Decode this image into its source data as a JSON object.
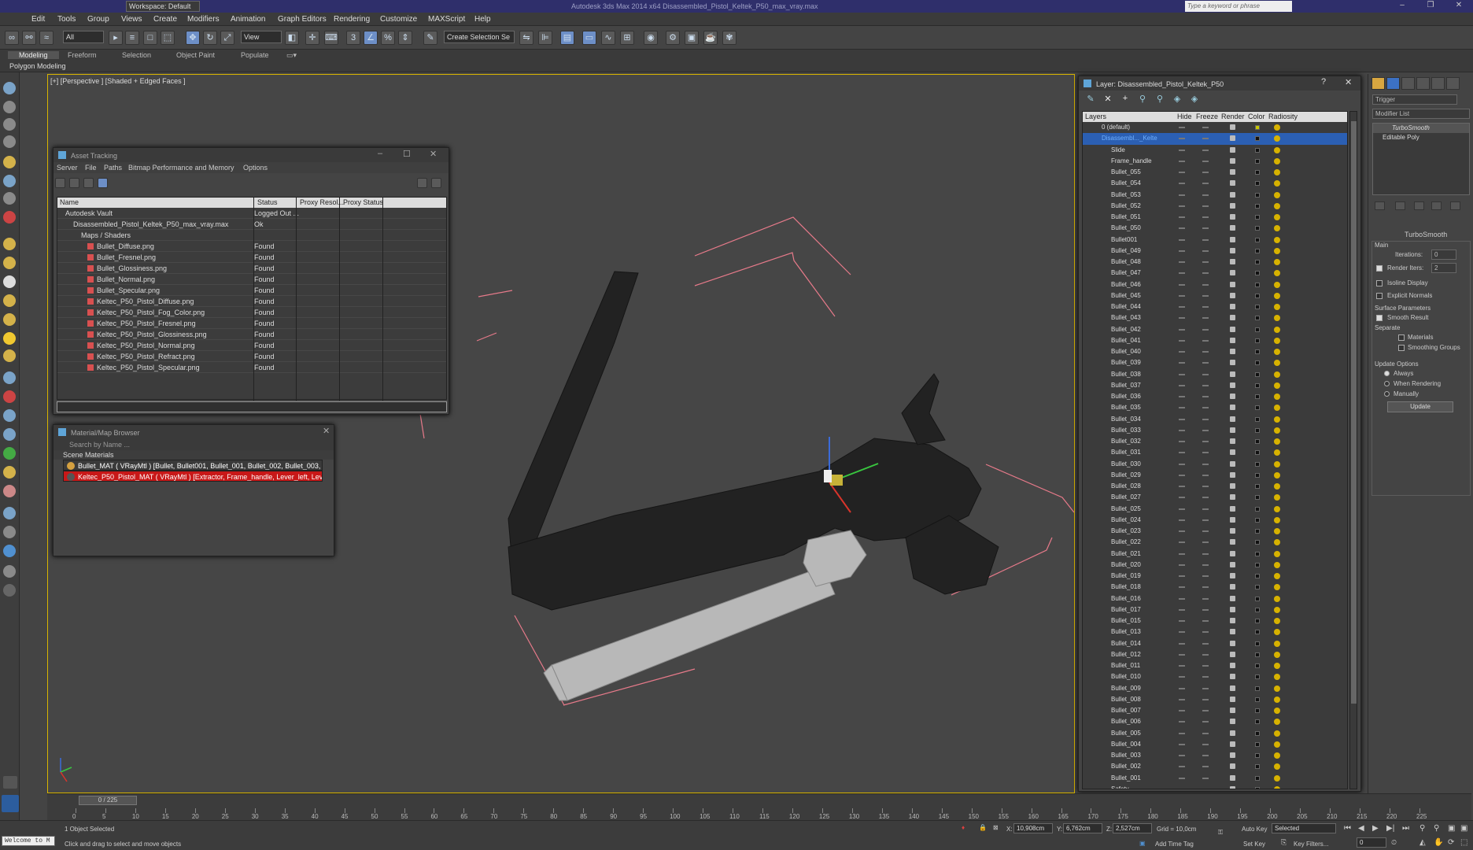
{
  "title_bar": {
    "workspace": "Workspace: Default",
    "title": "Autodesk 3ds Max  2014 x64     Disassembled_Pistol_Keltek_P50_max_vray.max",
    "search_placeholder": "Type a keyword or phrase"
  },
  "menu": [
    "Edit",
    "Tools",
    "Group",
    "Views",
    "Create",
    "Modifiers",
    "Animation",
    "Graph Editors",
    "Rendering",
    "Customize",
    "MAXScript",
    "Help"
  ],
  "toolbar": {
    "filter_value": "All",
    "refcoord_value": "View",
    "selection_set_value": "Create Selection Se"
  },
  "ribbon_tabs": [
    "Modeling",
    "Freeform",
    "Selection",
    "Object Paint",
    "Populate"
  ],
  "ribbon_sub": "Polygon Modeling",
  "viewport": {
    "label": "[+] [Perspective ] [Shaded + Edged Faces ]"
  },
  "asset_tracking": {
    "title": "Asset Tracking",
    "menu": [
      "Server",
      "File",
      "Paths",
      "Bitmap Performance and Memory",
      "Options"
    ],
    "columns": [
      "Name",
      "Status",
      "Proxy Resol...",
      "Proxy Status"
    ],
    "rows": [
      {
        "indent": 1,
        "name": "Autodesk Vault",
        "status": "Logged Out ..."
      },
      {
        "indent": 2,
        "name": "Disassembled_Pistol_Keltek_P50_max_vray.max",
        "status": "Ok"
      },
      {
        "indent": 3,
        "name": "Maps / Shaders",
        "status": ""
      },
      {
        "indent": 4,
        "name": "Bullet_Diffuse.png",
        "status": "Found"
      },
      {
        "indent": 4,
        "name": "Bullet_Fresnel.png",
        "status": "Found"
      },
      {
        "indent": 4,
        "name": "Bullet_Glossiness.png",
        "status": "Found"
      },
      {
        "indent": 4,
        "name": "Bullet_Normal.png",
        "status": "Found"
      },
      {
        "indent": 4,
        "name": "Bullet_Specular.png",
        "status": "Found"
      },
      {
        "indent": 4,
        "name": "Keltec_P50_Pistol_Diffuse.png",
        "status": "Found"
      },
      {
        "indent": 4,
        "name": "Keltec_P50_Pistol_Fog_Color.png",
        "status": "Found"
      },
      {
        "indent": 4,
        "name": "Keltec_P50_Pistol_Fresnel.png",
        "status": "Found"
      },
      {
        "indent": 4,
        "name": "Keltec_P50_Pistol_Glossiness.png",
        "status": "Found"
      },
      {
        "indent": 4,
        "name": "Keltec_P50_Pistol_Normal.png",
        "status": "Found"
      },
      {
        "indent": 4,
        "name": "Keltec_P50_Pistol_Refract.png",
        "status": "Found"
      },
      {
        "indent": 4,
        "name": "Keltec_P50_Pistol_Specular.png",
        "status": "Found"
      }
    ]
  },
  "material_browser": {
    "title": "Material/Map Browser",
    "search_placeholder": "Search by Name ...",
    "section": "Scene Materials",
    "items": [
      "Bullet_MAT  ( VRayMtl )  [Bullet, Bullet001, Bullet_001, Bullet_002, Bullet_003, B...",
      "Keltec_P50_Pistol_MAT  ( VRayMtl )  [Extractor, Frame_handle, Lever_left, Lever..."
    ]
  },
  "layer_panel": {
    "title": "Layer: Disassembled_Pistol_Keltek_P50",
    "columns": [
      "Layers",
      "Hide",
      "Freeze",
      "Render",
      "Color",
      "Radiosity"
    ],
    "layers": [
      "0 (default)",
      "Disassembl..._Kelte"
    ],
    "objects": [
      "Slide",
      "Frame_handle",
      "Bullet_055",
      "Bullet_054",
      "Bullet_053",
      "Bullet_052",
      "Bullet_051",
      "Bullet_050",
      "Bullet001",
      "Bullet_049",
      "Bullet_048",
      "Bullet_047",
      "Bullet_046",
      "Bullet_045",
      "Bullet_044",
      "Bullet_043",
      "Bullet_042",
      "Bullet_041",
      "Bullet_040",
      "Bullet_039",
      "Bullet_038",
      "Bullet_037",
      "Bullet_036",
      "Bullet_035",
      "Bullet_034",
      "Bullet_033",
      "Bullet_032",
      "Bullet_031",
      "Bullet_030",
      "Bullet_029",
      "Bullet_028",
      "Bullet_027",
      "Bullet_025",
      "Bullet_024",
      "Bullet_023",
      "Bullet_022",
      "Bullet_021",
      "Bullet_020",
      "Bullet_019",
      "Bullet_018",
      "Bullet_016",
      "Bullet_017",
      "Bullet_015",
      "Bullet_013",
      "Bullet_014",
      "Bullet_012",
      "Bullet_011",
      "Bullet_010",
      "Bullet_009",
      "Bullet_008",
      "Bullet_007",
      "Bullet_006",
      "Bullet_005",
      "Bullet_004",
      "Bullet_003",
      "Bullet_002",
      "Bullet_001",
      "Safety"
    ]
  },
  "command_panel": {
    "object_name": "Trigger",
    "modifier_list": "Modifier List",
    "stack": [
      "TurboSmooth",
      "Editable Poly"
    ],
    "rollout": "TurboSmooth",
    "main": "Main",
    "iterations_label": "Iterations:",
    "iterations_value": "0",
    "render_iters_label": "Render Iters:",
    "render_iters_value": "2",
    "isoline": "Isoline Display",
    "explicit_normals": "Explicit Normals",
    "surface_params": "Surface Parameters",
    "smooth_result": "Smooth Result",
    "separate": "Separate",
    "materials": "Materials",
    "smoothing_groups": "Smoothing Groups",
    "update_options": "Update Options",
    "always": "Always",
    "when_rendering": "When Rendering",
    "manually": "Manually",
    "update_btn": "Update"
  },
  "timeline": {
    "slider": "0 / 225",
    "ticks": [
      "0",
      "5",
      "10",
      "15",
      "20",
      "25",
      "30",
      "35",
      "40",
      "45",
      "50",
      "55",
      "60",
      "65",
      "70",
      "75",
      "80",
      "85",
      "90",
      "95",
      "100",
      "105",
      "110",
      "115",
      "120",
      "125",
      "130",
      "135",
      "140",
      "145",
      "150",
      "155",
      "160",
      "165",
      "170",
      "175",
      "180",
      "185",
      "190",
      "195",
      "200",
      "205",
      "210",
      "215",
      "220",
      "225"
    ]
  },
  "status": {
    "welcome": "Welcome to M",
    "selected": "1 Object Selected",
    "prompt": "Click and drag to select and move objects",
    "x_label": "X:",
    "x": "10,908cm",
    "y_label": "Y:",
    "y": "6,762cm",
    "z_label": "Z:",
    "z": "2,527cm",
    "grid": "Grid = 10,0cm",
    "add_time_tag": "Add Time Tag",
    "auto_key": "Auto Key",
    "set_key": "Set Key",
    "selected_dropdown": "Selected",
    "key_filters": "Key Filters...",
    "frame": "0"
  }
}
